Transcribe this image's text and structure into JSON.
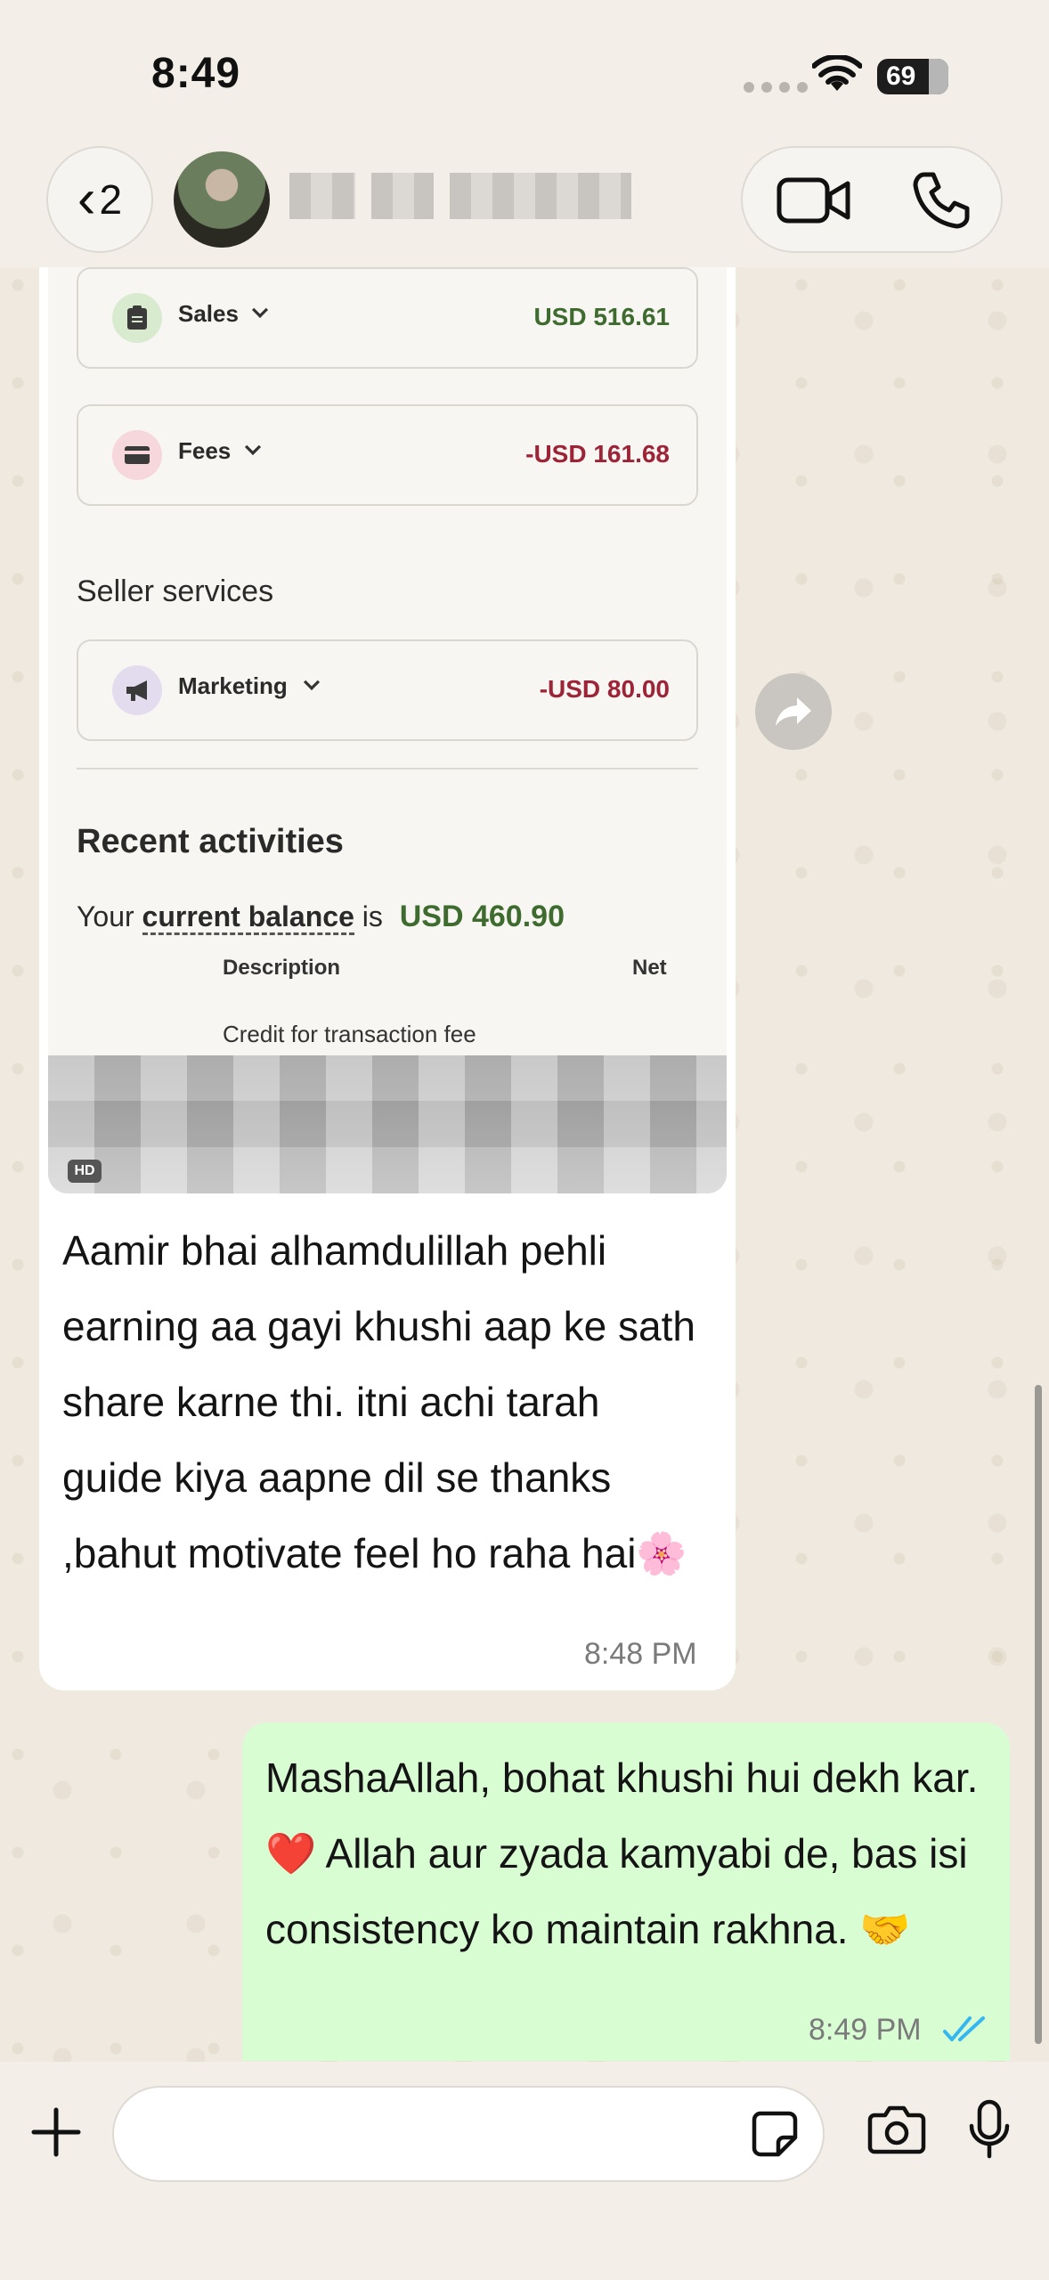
{
  "status_bar": {
    "time": "8:49",
    "battery": "69"
  },
  "header": {
    "back_count": "2"
  },
  "incoming": {
    "screenshot": {
      "cards": [
        {
          "label": "Sales",
          "amount": "USD 516.61",
          "icon": "clipboard-icon",
          "color": "#3e6b2e"
        },
        {
          "label": "Fees",
          "amount": "-USD 161.68",
          "icon": "card-icon",
          "color": "#9c2436"
        },
        {
          "label": "Marketing",
          "amount": "-USD 80.00",
          "icon": "megaphone-icon",
          "color": "#9c2436"
        }
      ],
      "section_title": "Seller services",
      "recent_title": "Recent activities",
      "balance_prefix": "Your",
      "balance_link": "current balance",
      "balance_mid": "is",
      "balance_amount": "USD 460.90",
      "columns": {
        "description": "Description",
        "net": "Net"
      },
      "row_description": "Credit for transaction fee",
      "hd_badge": "HD"
    },
    "text": "Aamir bhai alhamdulillah pehli earning aa gayi khushi aap ke sath share karne thi. itni achi tarah guide kiya aapne dil se thanks ,bahut motivate feel ho raha hai🌸",
    "time": "8:48 PM"
  },
  "outgoing": {
    "text": "MashaAllah, bohat khushi hui dekh kar. ❤️ Allah aur zyada kamyabi de, bas isi consistency ko maintain rakhna. 🤝",
    "time": "8:49 PM"
  },
  "input": {
    "placeholder": ""
  },
  "colors": {
    "incoming_bubble": "#ffffff",
    "outgoing_bubble": "#d9fdd3",
    "read_ticks": "#34b7f1"
  }
}
